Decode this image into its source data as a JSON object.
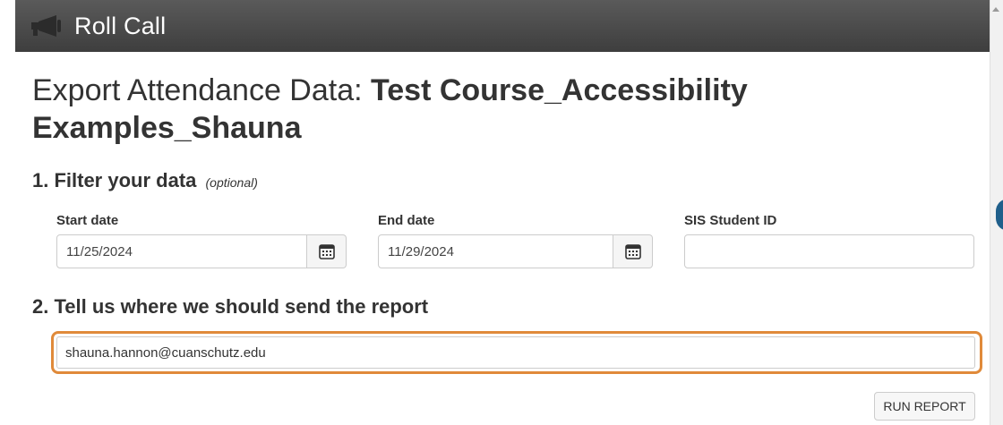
{
  "header": {
    "title": "Roll Call",
    "logo_icon": "megaphone-icon"
  },
  "page": {
    "title_prefix": "Export Attendance Data: ",
    "course_name": "Test Course_Accessibility Examples_Shauna"
  },
  "filter_section": {
    "heading": "1. Filter your data",
    "optional_note": "(optional)",
    "start_date": {
      "label": "Start date",
      "value": "11/25/2024",
      "icon": "calendar-icon"
    },
    "end_date": {
      "label": "End date",
      "value": "11/29/2024",
      "icon": "calendar-icon"
    },
    "sis_student_id": {
      "label": "SIS Student ID",
      "value": ""
    }
  },
  "send_section": {
    "heading": "2. Tell us where we should send the report",
    "email_value": "shauna.hannon@cuanschutz.edu",
    "highlight_color": "#e08a3a"
  },
  "actions": {
    "run_report_label": "RUN REPORT"
  },
  "colors": {
    "header_bg": "#474747",
    "accent_highlight": "#e08a3a"
  }
}
